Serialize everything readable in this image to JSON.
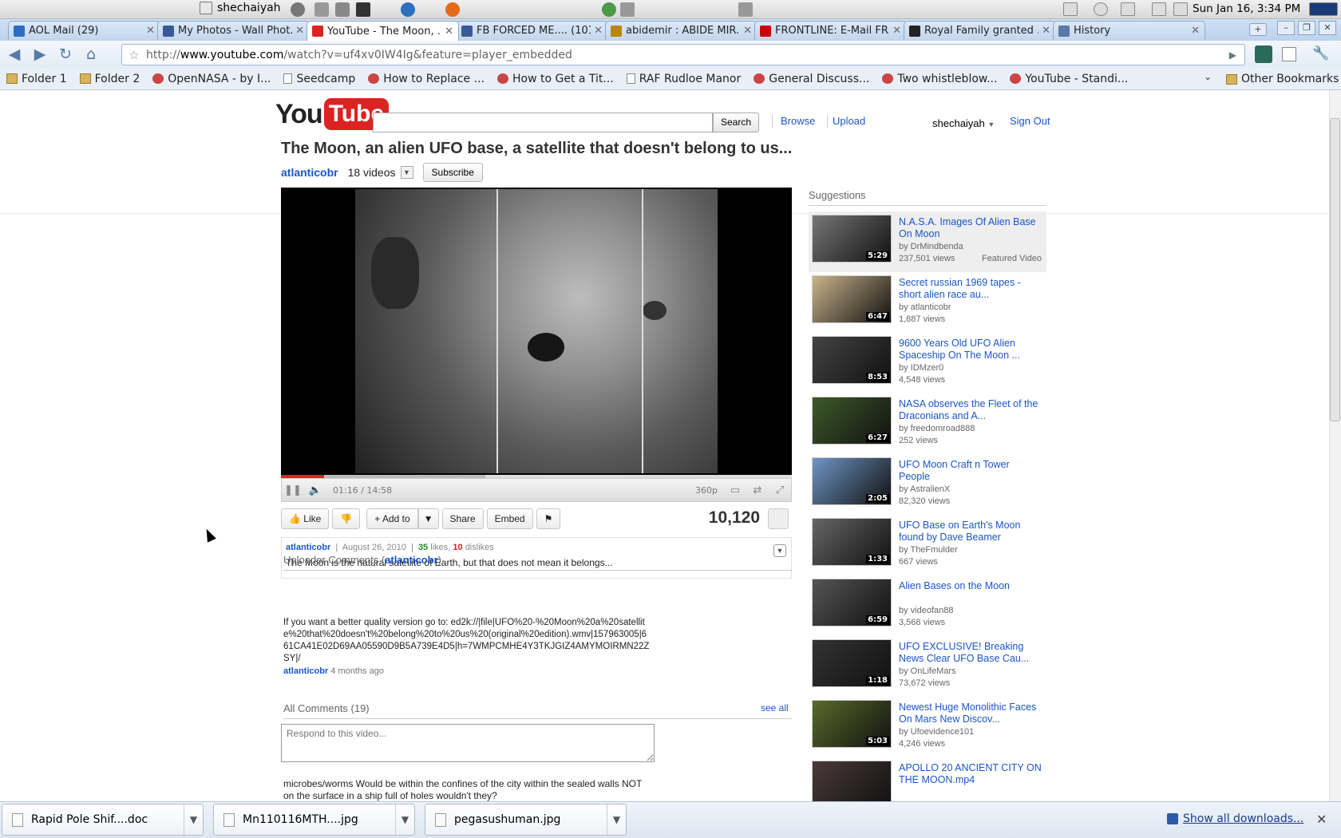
{
  "taskbar": {
    "user": "shechaiyah",
    "clock": "Sun Jan 16,  3:34 PM"
  },
  "tabs": [
    {
      "label": "AOL Mail (29)",
      "fav": "#2b6fc4"
    },
    {
      "label": "My Photos - Wall Phot...",
      "fav": "#3b5998"
    },
    {
      "label": "YouTube - The Moon, ...",
      "fav": "#d22"
    },
    {
      "label": "FB FORCED ME.... (101)",
      "fav": "#3b5998"
    },
    {
      "label": "abidemir : ABIDE MIR...",
      "fav": "#b8860b"
    },
    {
      "label": "FRONTLINE: E-Mail FR...",
      "fav": "#c00"
    },
    {
      "label": "Royal Family granted ...",
      "fav": "#222"
    },
    {
      "label": "History",
      "fav": "#5a7aa6"
    }
  ],
  "active_tab": 2,
  "address": {
    "prefix": "http://",
    "host": "www.youtube.com",
    "path": "/watch?v=uf4xv0IW4Ig&feature=player_embedded"
  },
  "bookmarks": [
    {
      "label": "Folder 1",
      "type": "folder"
    },
    {
      "label": "Folder 2",
      "type": "folder"
    },
    {
      "label": "OpenNASA - by I...",
      "type": "site"
    },
    {
      "label": "Seedcamp",
      "type": "page"
    },
    {
      "label": "How to Replace ...",
      "type": "site"
    },
    {
      "label": "How to Get a Tit...",
      "type": "site"
    },
    {
      "label": "RAF Rudloe Manor",
      "type": "page"
    },
    {
      "label": "General Discuss...",
      "type": "site"
    },
    {
      "label": "Two whistleblow...",
      "type": "site"
    },
    {
      "label": "YouTube - Standi...",
      "type": "site"
    }
  ],
  "other_bookmarks": "Other Bookmarks",
  "youtube": {
    "logo_you": "You",
    "logo_tube": "Tube",
    "search_button": "Search",
    "browse": "Browse",
    "upload": "Upload",
    "username": "shechaiyah",
    "sign_out": "Sign Out"
  },
  "video": {
    "title": "The Moon, an alien UFO base, a satellite that doesn't belong to us...",
    "channel": "atlanticobr",
    "video_count": "18 videos",
    "subscribe": "Subscribe",
    "time": "01:16 / 14:58",
    "quality": "360p",
    "played_fraction": 0.085,
    "loaded_fraction": 0.4,
    "views": "10,120",
    "like": "Like",
    "add_to": "Add to",
    "share": "Share",
    "embed": "Embed",
    "date": "August 26, 2010",
    "likes": "35",
    "likes_label": "likes,",
    "dislikes": "10",
    "dislikes_label": "dislikes",
    "description": "The Moon is the natural satellite of Earth, but that does not mean it belongs..."
  },
  "uploader_comments": {
    "heading": "Uploader Comments",
    "user": "atlanticobr",
    "text": "If you want a better quality version go to: ed2k://|file|UFO%20-%20Moon%20a%20satellite%20that%20doesn't%20belong%20to%20us%20(original%20edition).wmv|157963005|661CA41E02D69AA05590D9B5A739E4D5|h=7WMPCMHE4Y3TKJGIZ4AMYMOIRMN22ZSY|/",
    "by": "atlanticobr",
    "when": "4 months ago"
  },
  "all_comments": {
    "heading": "All Comments (19)",
    "see_all": "see all",
    "placeholder": "Respond to this video...",
    "first_comment": "microbes/worms Would be within the confines of the city within the sealed walls NOT on the surface in a ship full of holes wouldn't they?"
  },
  "suggestions_heading": "Suggestions",
  "suggestions": [
    {
      "title": "N.A.S.A. Images Of Alien Base On Moon",
      "by": "by DrMindbenda",
      "views": "237,501 views",
      "duration": "5:29",
      "featured": "Featured Video",
      "thumb": "#777"
    },
    {
      "title": "Secret russian 1969 tapes - short alien race au...",
      "by": "by atlanticobr",
      "views": "1,887 views",
      "duration": "6:47",
      "featured": "",
      "thumb": "#c9b48a"
    },
    {
      "title": "9600 Years Old UFO Alien Spaceship On The Moon ...",
      "by": "by IDMzer0",
      "views": "4,548 views",
      "duration": "8:53",
      "featured": "",
      "thumb": "#444"
    },
    {
      "title": "NASA observes the Fleet of the Draconians and A...",
      "by": "by freedomroad888",
      "views": "252 views",
      "duration": "6:27",
      "featured": "",
      "thumb": "#3d5a2a"
    },
    {
      "title": "UFO Moon Craft n Tower People",
      "by": "by AstralienX",
      "views": "82,320 views",
      "duration": "2:05",
      "featured": "",
      "thumb": "#6f95c4"
    },
    {
      "title": "UFO Base on Earth's Moon found by Dave Beamer",
      "by": "by TheFmulder",
      "views": "667 views",
      "duration": "1:33",
      "featured": "",
      "thumb": "#666"
    },
    {
      "title": "Alien Bases on the Moon",
      "by": "by videofan88",
      "views": "3,568 views",
      "duration": "6:59",
      "featured": "",
      "thumb": "#555"
    },
    {
      "title": "UFO EXCLUSIVE! Breaking News Clear UFO Base Cau...",
      "by": "by OnLifeMars",
      "views": "73,672 views",
      "duration": "1:18",
      "featured": "",
      "thumb": "#333"
    },
    {
      "title": "Newest Huge Monolithic Faces On Mars New Discov...",
      "by": "by Ufoevidence101",
      "views": "4,246 views",
      "duration": "5:03",
      "featured": "",
      "thumb": "#5a6a2a"
    },
    {
      "title": "APOLLO 20 ANCIENT CITY ON THE MOON.mp4",
      "by": "",
      "views": "",
      "duration": "",
      "featured": "",
      "thumb": "#4a3a3a"
    }
  ],
  "downloads": [
    {
      "name": "Rapid Pole Shif....doc"
    },
    {
      "name": "Mn110116MTH....jpg"
    },
    {
      "name": "pegasushuman.jpg"
    }
  ],
  "show_all_downloads": "Show all downloads..."
}
